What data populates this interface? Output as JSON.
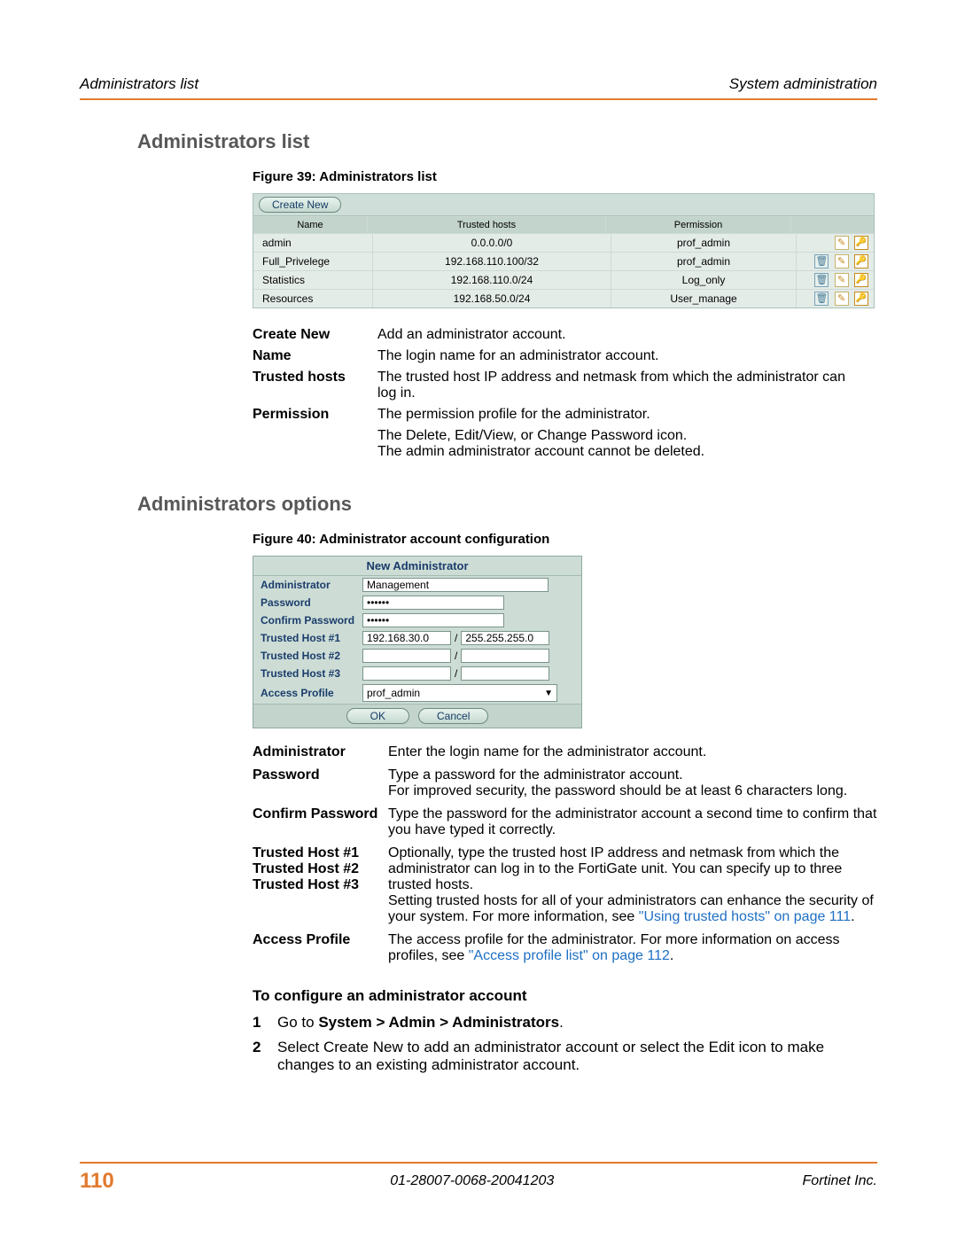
{
  "header": {
    "left": "Administrators list",
    "right": "System administration"
  },
  "section1": {
    "title": "Administrators list",
    "figCaption": "Figure 39: Administrators list",
    "toolbarBtn": "Create New",
    "cols": {
      "name": "Name",
      "hosts": "Trusted hosts",
      "perm": "Permission"
    },
    "rows": [
      {
        "name": "admin",
        "hosts": "0.0.0.0/0",
        "perm": "prof_admin",
        "hasDelete": false
      },
      {
        "name": "Full_Privelege",
        "hosts": "192.168.110.100/32",
        "perm": "prof_admin",
        "hasDelete": true
      },
      {
        "name": "Statistics",
        "hosts": "192.168.110.0/24",
        "perm": "Log_only",
        "hasDelete": true
      },
      {
        "name": "Resources",
        "hosts": "192.168.50.0/24",
        "perm": "User_manage",
        "hasDelete": true
      }
    ],
    "defs": {
      "createNew": {
        "k": "Create New",
        "v": "Add an administrator account."
      },
      "name": {
        "k": "Name",
        "v": "The login name for an administrator account."
      },
      "trusted": {
        "k": "Trusted hosts",
        "v": "The trusted host IP address and netmask from which the administrator can log in."
      },
      "permission": {
        "k": "Permission",
        "v": "The permission profile for the administrator."
      },
      "iconsNote1": "The Delete, Edit/View, or Change Password icon.",
      "iconsNote2": "The admin administrator account cannot be deleted."
    }
  },
  "section2": {
    "title": "Administrators options",
    "figCaption": "Figure 40: Administrator account configuration",
    "form": {
      "title": "New Administrator",
      "labels": {
        "admin": "Administrator",
        "pwd": "Password",
        "cpwd": "Confirm Password",
        "th1": "Trusted Host #1",
        "th2": "Trusted Host #2",
        "th3": "Trusted Host #3",
        "profile": "Access Profile"
      },
      "values": {
        "admin": "Management",
        "pwd": "••••••",
        "cpwd": "••••••",
        "th1_ip": "192.168.30.0",
        "th1_mask": "255.255.255.0",
        "th2_ip": "",
        "th2_mask": "",
        "th3_ip": "",
        "th3_mask": "",
        "profile": "prof_admin"
      },
      "ok": "OK",
      "cancel": "Cancel",
      "slash": "/"
    },
    "defs": {
      "admin": {
        "k": "Administrator",
        "v": "Enter the login name for the administrator account."
      },
      "pwd": {
        "k": "Password",
        "v": "Type a password for the administrator account.\nFor improved security, the password should be at least 6 characters long."
      },
      "cpwd": {
        "k": "Confirm Password",
        "v": "Type the password for the administrator account a second time to confirm that you have typed it correctly."
      },
      "th": {
        "k1": "Trusted Host #1",
        "k2": "Trusted Host #2",
        "k3": "Trusted Host #3",
        "v1": "Optionally, type the trusted host IP address and netmask from which the administrator can log in to the FortiGate unit. You can specify up to three trusted hosts.",
        "v2a": "Setting trusted hosts for all of your administrators can enhance the security of your system. For more information, see ",
        "link1": "\"Using trusted hosts\" on page 111",
        "v2b": "."
      },
      "ap": {
        "k": "Access Profile",
        "v1": "The access profile for the administrator. For more information on access profiles, see ",
        "link": "\"Access profile list\" on page 112",
        "v2": "."
      }
    },
    "procTitle": "To configure an administrator account",
    "steps": {
      "s1n": "1",
      "s1a": "Go to ",
      "s1b": "System > Admin > Administrators",
      "s1c": ".",
      "s2n": "2",
      "s2": "Select Create New to add an administrator account or select the Edit icon to make changes to an existing administrator account."
    }
  },
  "footer": {
    "page": "110",
    "docid": "01-28007-0068-20041203",
    "company": "Fortinet Inc."
  }
}
